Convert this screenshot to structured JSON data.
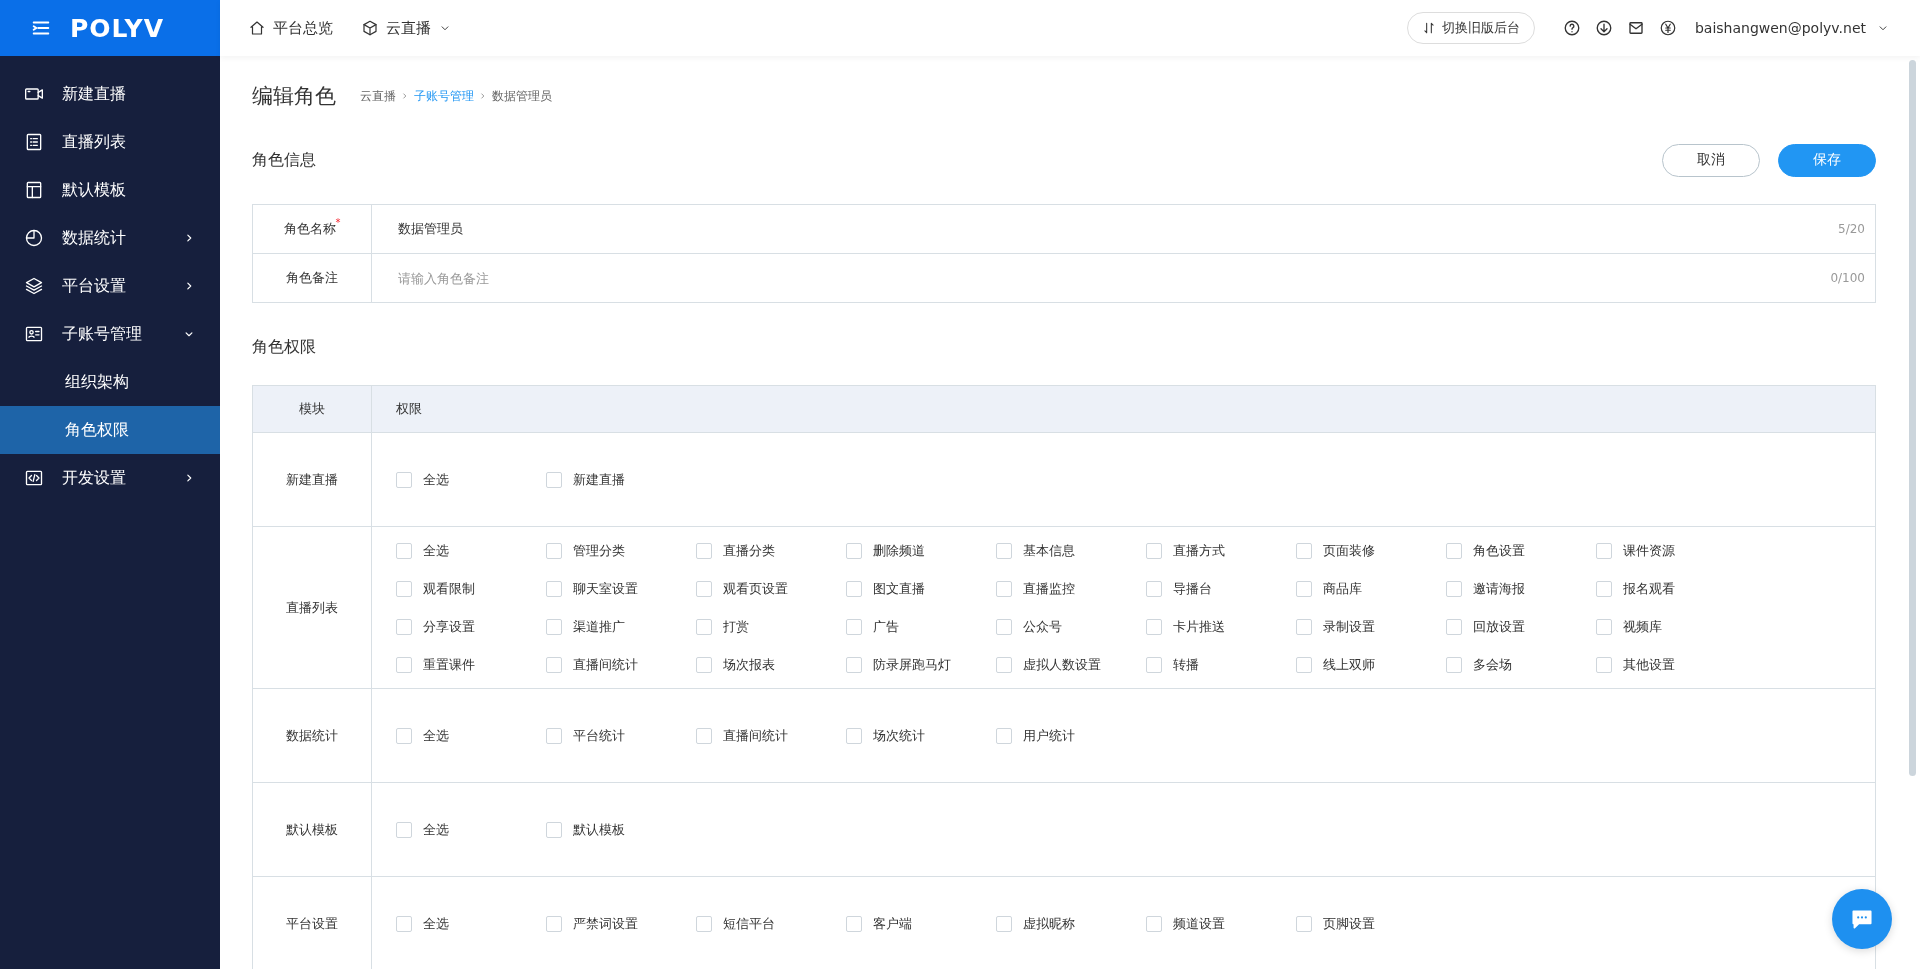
{
  "header": {
    "logo": "POLYV",
    "nav": [
      {
        "label": "平台总览",
        "kind": "home",
        "dropdown": false
      },
      {
        "label": "云直播",
        "kind": "cube",
        "dropdown": true
      }
    ],
    "switch_button": "切换旧版后台",
    "user_email": "baishangwen@polyv.net"
  },
  "sidebar": {
    "items": [
      {
        "label": "新建直播",
        "kind": "link",
        "selected": false
      },
      {
        "label": "直播列表",
        "kind": "link",
        "selected": false
      },
      {
        "label": "默认模板",
        "kind": "link",
        "selected": false
      },
      {
        "label": "数据统计",
        "kind": "group",
        "selected": false,
        "expanded": false
      },
      {
        "label": "平台设置",
        "kind": "group",
        "selected": false,
        "expanded": false
      },
      {
        "label": "子账号管理",
        "kind": "group",
        "selected": false,
        "expanded": true,
        "children": [
          {
            "label": "组织架构",
            "selected": false
          },
          {
            "label": "角色权限",
            "selected": true
          }
        ]
      },
      {
        "label": "开发设置",
        "kind": "group",
        "selected": false,
        "expanded": false
      }
    ]
  },
  "page": {
    "title": "编辑角色",
    "breadcrumb": [
      {
        "label": "云直播",
        "link": false
      },
      {
        "label": "子账号管理",
        "link": true
      },
      {
        "label": "数据管理员",
        "link": false
      }
    ],
    "info_section": "角色信息",
    "buttons": [
      {
        "label": "取消",
        "kind": "secondary"
      },
      {
        "label": "保存",
        "kind": "primary"
      }
    ],
    "info_fields": [
      {
        "label": "角色名称",
        "required_mark": "*",
        "value": "数据管理员",
        "counter": "5/20"
      },
      {
        "label": "角色备注",
        "placeholder": "请输入角色备注",
        "counter": "0/100"
      }
    ],
    "permission_section": "角色权限",
    "table": {
      "columns": [
        "模块",
        "权限"
      ],
      "rows": [
        {
          "module": "新建直播",
          "permissions": [
            {
              "label": "全选",
              "checked": false
            },
            {
              "label": "新建直播",
              "checked": false
            }
          ]
        },
        {
          "module": "直播列表",
          "permissions": [
            {
              "label": "全选",
              "checked": false
            },
            {
              "label": "管理分类",
              "checked": false
            },
            {
              "label": "直播分类",
              "checked": false
            },
            {
              "label": "删除频道",
              "checked": false
            },
            {
              "label": "基本信息",
              "checked": false
            },
            {
              "label": "直播方式",
              "checked": false
            },
            {
              "label": "页面装修",
              "checked": false
            },
            {
              "label": "角色设置",
              "checked": false
            },
            {
              "label": "课件资源",
              "checked": false
            },
            {
              "label": "观看限制",
              "checked": false
            },
            {
              "label": "聊天室设置",
              "checked": false
            },
            {
              "label": "观看页设置",
              "checked": false
            },
            {
              "label": "图文直播",
              "checked": false
            },
            {
              "label": "直播监控",
              "checked": false
            },
            {
              "label": "导播台",
              "checked": false
            },
            {
              "label": "商品库",
              "checked": false
            },
            {
              "label": "邀请海报",
              "checked": false
            },
            {
              "label": "报名观看",
              "checked": false
            },
            {
              "label": "分享设置",
              "checked": false
            },
            {
              "label": "渠道推广",
              "checked": false
            },
            {
              "label": "打赏",
              "checked": false
            },
            {
              "label": "广告",
              "checked": false
            },
            {
              "label": "公众号",
              "checked": false
            },
            {
              "label": "卡片推送",
              "checked": false
            },
            {
              "label": "录制设置",
              "checked": false
            },
            {
              "label": "回放设置",
              "checked": false
            },
            {
              "label": "视频库",
              "checked": false
            },
            {
              "label": "重置课件",
              "checked": false
            },
            {
              "label": "直播间统计",
              "checked": false
            },
            {
              "label": "场次报表",
              "checked": false
            },
            {
              "label": "防录屏跑马灯",
              "checked": false
            },
            {
              "label": "虚拟人数设置",
              "checked": false
            },
            {
              "label": "转播",
              "checked": false
            },
            {
              "label": "线上双师",
              "checked": false
            },
            {
              "label": "多会场",
              "checked": false
            },
            {
              "label": "其他设置",
              "checked": false
            }
          ]
        },
        {
          "module": "数据统计",
          "permissions": [
            {
              "label": "全选",
              "checked": false
            },
            {
              "label": "平台统计",
              "checked": false
            },
            {
              "label": "直播间统计",
              "checked": false
            },
            {
              "label": "场次统计",
              "checked": false
            },
            {
              "label": "用户统计",
              "checked": false
            }
          ]
        },
        {
          "module": "默认模板",
          "permissions": [
            {
              "label": "全选",
              "checked": false
            },
            {
              "label": "默认模板",
              "checked": false
            }
          ]
        },
        {
          "module": "平台设置",
          "permissions": [
            {
              "label": "全选",
              "checked": false
            },
            {
              "label": "严禁词设置",
              "checked": false
            },
            {
              "label": "短信平台",
              "checked": false
            },
            {
              "label": "客户端",
              "checked": false
            },
            {
              "label": "虚拟昵称",
              "checked": false
            },
            {
              "label": "频道设置",
              "checked": false
            },
            {
              "label": "页脚设置",
              "checked": false
            }
          ]
        }
      ]
    }
  }
}
